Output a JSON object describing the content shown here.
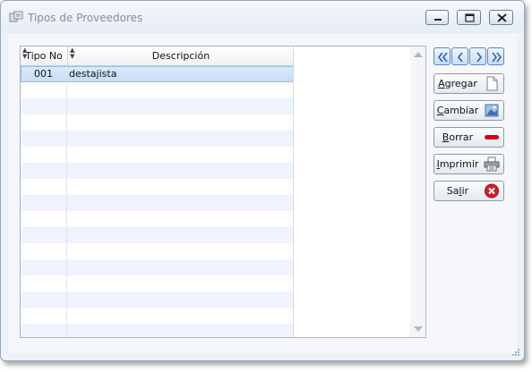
{
  "window": {
    "title": "Tipos de Proveedores",
    "controls": [
      "minimize-icon",
      "maximize-icon",
      "close-icon"
    ]
  },
  "grid": {
    "columns": [
      "Tipo No",
      "Descripción"
    ],
    "rows": [
      {
        "tipo_no": "001",
        "descripcion": "destajista",
        "selected": true
      }
    ]
  },
  "navigation": [
    "first-record-icon",
    "previous-record-icon",
    "next-record-icon",
    "last-record-icon"
  ],
  "actions": {
    "agregar": {
      "prefix": "",
      "underlined": "A",
      "rest": "gregar",
      "icon": "new-document-icon"
    },
    "cambiar": {
      "prefix": "",
      "underlined": "C",
      "rest": "ambiar",
      "icon": "picture-edit-icon"
    },
    "borrar": {
      "prefix": "",
      "underlined": "B",
      "rest": "orrar",
      "icon": "red-minus-icon"
    },
    "imprimir": {
      "prefix": "",
      "underlined": "I",
      "rest": "mprimir",
      "icon": "printer-icon"
    },
    "salir": {
      "prefix": "Sa",
      "underlined": "l",
      "rest": "ir",
      "icon": "red-x-icon"
    }
  },
  "colors": {
    "selected_row": "#c4dcf6",
    "alt_row": "#eef4fb",
    "nav_border": "#5b86c4",
    "borrar_icon": "#d0021b",
    "salir_icon": "#d21f2a"
  }
}
